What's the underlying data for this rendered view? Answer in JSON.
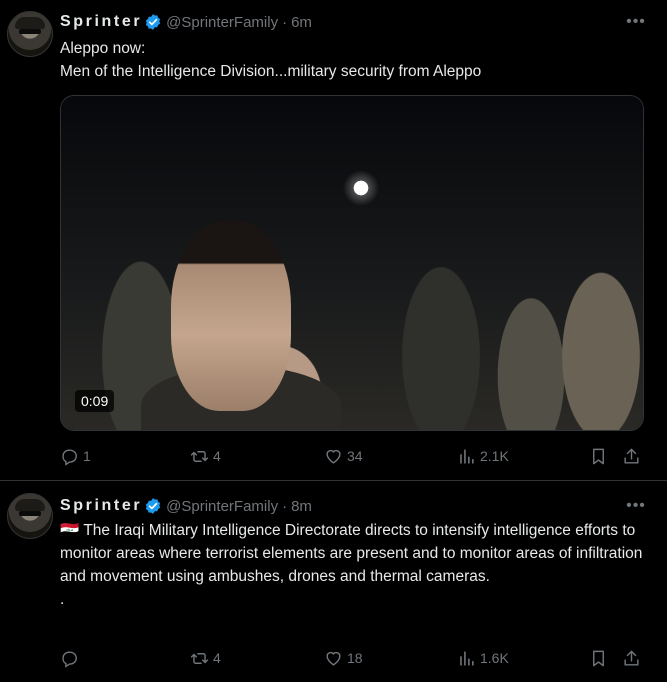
{
  "tweets": [
    {
      "name": "Sprinter",
      "handle": "@SprinterFamily",
      "separator": "·",
      "time": "6m",
      "more": "•••",
      "text": "Aleppo now:\nMen of the Intelligence Division...military security from Aleppo",
      "media": {
        "duration": "0:09"
      },
      "replies": "1",
      "reposts": "4",
      "likes": "34",
      "views": "2.1K"
    },
    {
      "name": "Sprinter",
      "handle": "@SprinterFamily",
      "separator": "·",
      "time": "8m",
      "more": "•••",
      "text": "🇮🇶 The Iraqi Military Intelligence Directorate directs to intensify intelligence efforts to monitor areas where terrorist elements are present and to monitor areas of infiltration and movement using ambushes, drones and thermal cameras.\n.",
      "replies": "",
      "reposts": "4",
      "likes": "18",
      "views": "1.6K"
    }
  ],
  "colors": {
    "accent": "#1d9bf0",
    "muted": "#71767b",
    "text": "#e7e9ea",
    "divider": "#2f3336"
  },
  "icons": [
    "verified-badge-icon",
    "more-icon",
    "reply-icon",
    "repost-icon",
    "like-icon",
    "views-icon",
    "bookmark-icon",
    "share-icon"
  ]
}
